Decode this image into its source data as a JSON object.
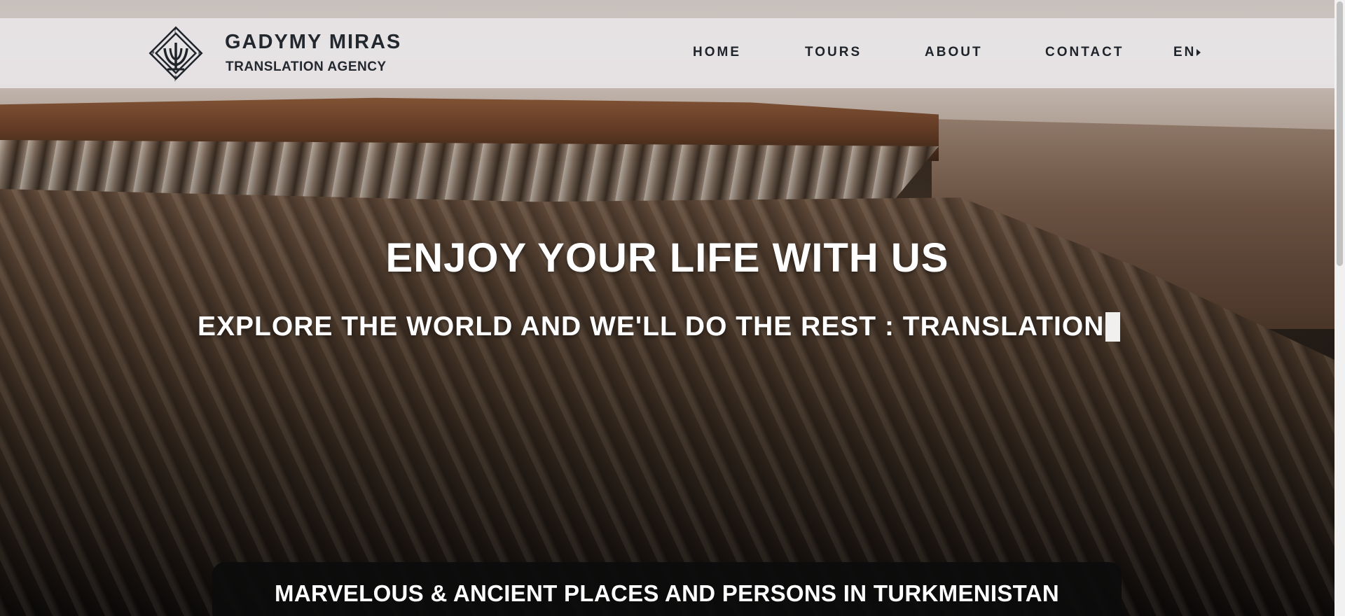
{
  "brand": {
    "name": "GADYMY MIRAS",
    "subtitle": "TRANSLATION AGENCY",
    "logo_icon": "trident-emblem-icon"
  },
  "nav": {
    "items": [
      {
        "label": "HOME"
      },
      {
        "label": "TOURS"
      },
      {
        "label": "ABOUT"
      },
      {
        "label": "CONTACT"
      }
    ],
    "language": "EN",
    "language_icon": "caret-right-icon"
  },
  "hero": {
    "title": "ENJOY YOUR LIFE WITH US",
    "subtitle": "EXPLORE THE WORLD AND WE'LL DO THE REST : TRANSLATION",
    "background": "canyon-plateau-landscape"
  },
  "banner": {
    "text": "MARVELOUS & ANCIENT PLACES AND PERSONS IN TURKMENISTAN"
  },
  "colors": {
    "header_bg": "#e8e5e7",
    "text_dark": "#23282f",
    "hero_text": "#ffffff",
    "banner_bg": "#0c0c0c"
  }
}
